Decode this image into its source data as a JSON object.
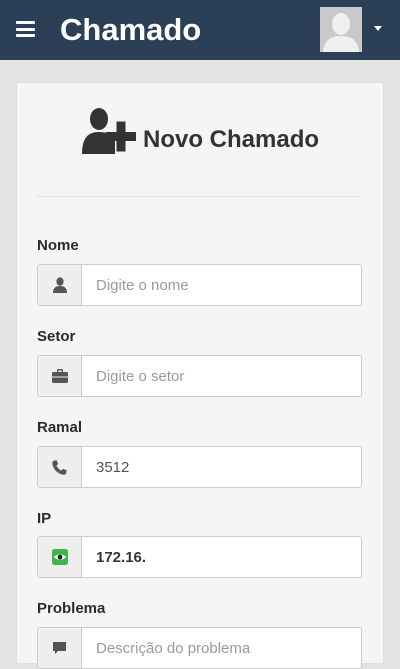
{
  "navbar": {
    "brand": "Chamado",
    "menu_icon": "hamburger-icon",
    "avatar_icon": "user-avatar-silhouette",
    "dropdown_icon": "caret-down-icon",
    "background": "#2b3f57"
  },
  "form": {
    "title": "Novo Chamado",
    "title_icon": "user-plus-icon",
    "fields": {
      "nome": {
        "label": "Nome",
        "icon": "user-icon",
        "placeholder": "Digite o nome",
        "value": ""
      },
      "setor": {
        "label": "Setor",
        "icon": "briefcase-icon",
        "placeholder": "Digite o setor",
        "value": ""
      },
      "ramal": {
        "label": "Ramal",
        "icon": "phone-icon",
        "placeholder": "",
        "value": "3512"
      },
      "ip": {
        "label": "IP",
        "icon": "eye-icon",
        "placeholder": "",
        "value": "172.16.",
        "icon_color": "#3fb54a"
      },
      "problema": {
        "label": "Problema",
        "icon": "comment-icon",
        "placeholder": "Descrição do problema",
        "value": ""
      }
    }
  }
}
